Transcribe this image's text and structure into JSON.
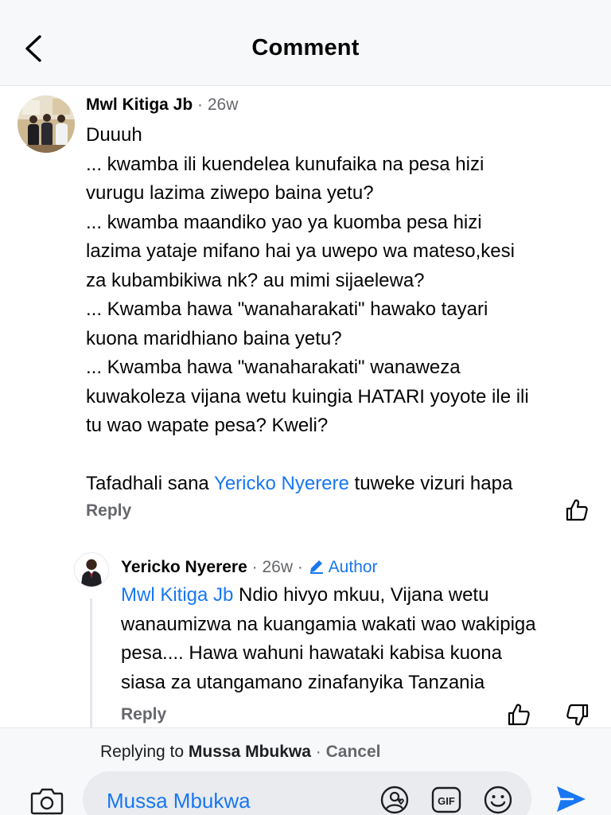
{
  "header": {
    "title": "Comment"
  },
  "comment": {
    "author": "Mwl Kitiga Jb",
    "time": "26w",
    "lines": [
      "Duuuh",
      "... kwamba ili kuendelea kunufaika na pesa hizi",
      "vurugu lazima ziwepo baina yetu?",
      "... kwamba maandiko yao ya kuomba pesa hizi",
      "lazima yataje mifano hai ya uwepo wa mateso,kesi",
      "za kubambikiwa nk? au mimi sijaelewa?",
      "... Kwamba hawa \"wanaharakati\" hawako tayari",
      "kuona maridhiano baina yetu?",
      "... Kwamba hawa \"wanaharakati\" wanaweza",
      "kuwakoleza vijana wetu kuingia HATARI yoyote ile ili",
      "tu wao wapate pesa? Kweli?"
    ],
    "closing_prefix": "Tafadhali sana ",
    "closing_mention": "Yericko Nyerere",
    "closing_suffix": " tuweke vizuri hapa",
    "reply_label": "Reply"
  },
  "reply": {
    "author": "Yericko Nyerere",
    "time": "26w",
    "badge": "Author",
    "mention": "Mwl Kitiga Jb",
    "line1_rest": " Ndio hivyo mkuu, Vijana wetu",
    "lines": [
      "wanaumizwa na kuangamia wakati wao wakipiga",
      "pesa.... Hawa wahuni hawataki kabisa kuona",
      "siasa za utangamano zinafanyika Tanzania"
    ],
    "reply_label": "Reply"
  },
  "composer": {
    "replying_prefix": "Replying to ",
    "replying_name": "Mussa Mbukwa",
    "separator": " · ",
    "cancel_label": "Cancel",
    "input_value": "Mussa Mbukwa"
  },
  "colors": {
    "accent": "#1877f2",
    "secondary_text": "#65676b",
    "header_bg": "#f7f8fa"
  },
  "icons": [
    "back-arrow-icon",
    "like-icon",
    "dislike-icon",
    "pencil-icon",
    "camera-icon",
    "avatar-sticker-icon",
    "gif-icon",
    "emoji-icon",
    "send-icon"
  ]
}
